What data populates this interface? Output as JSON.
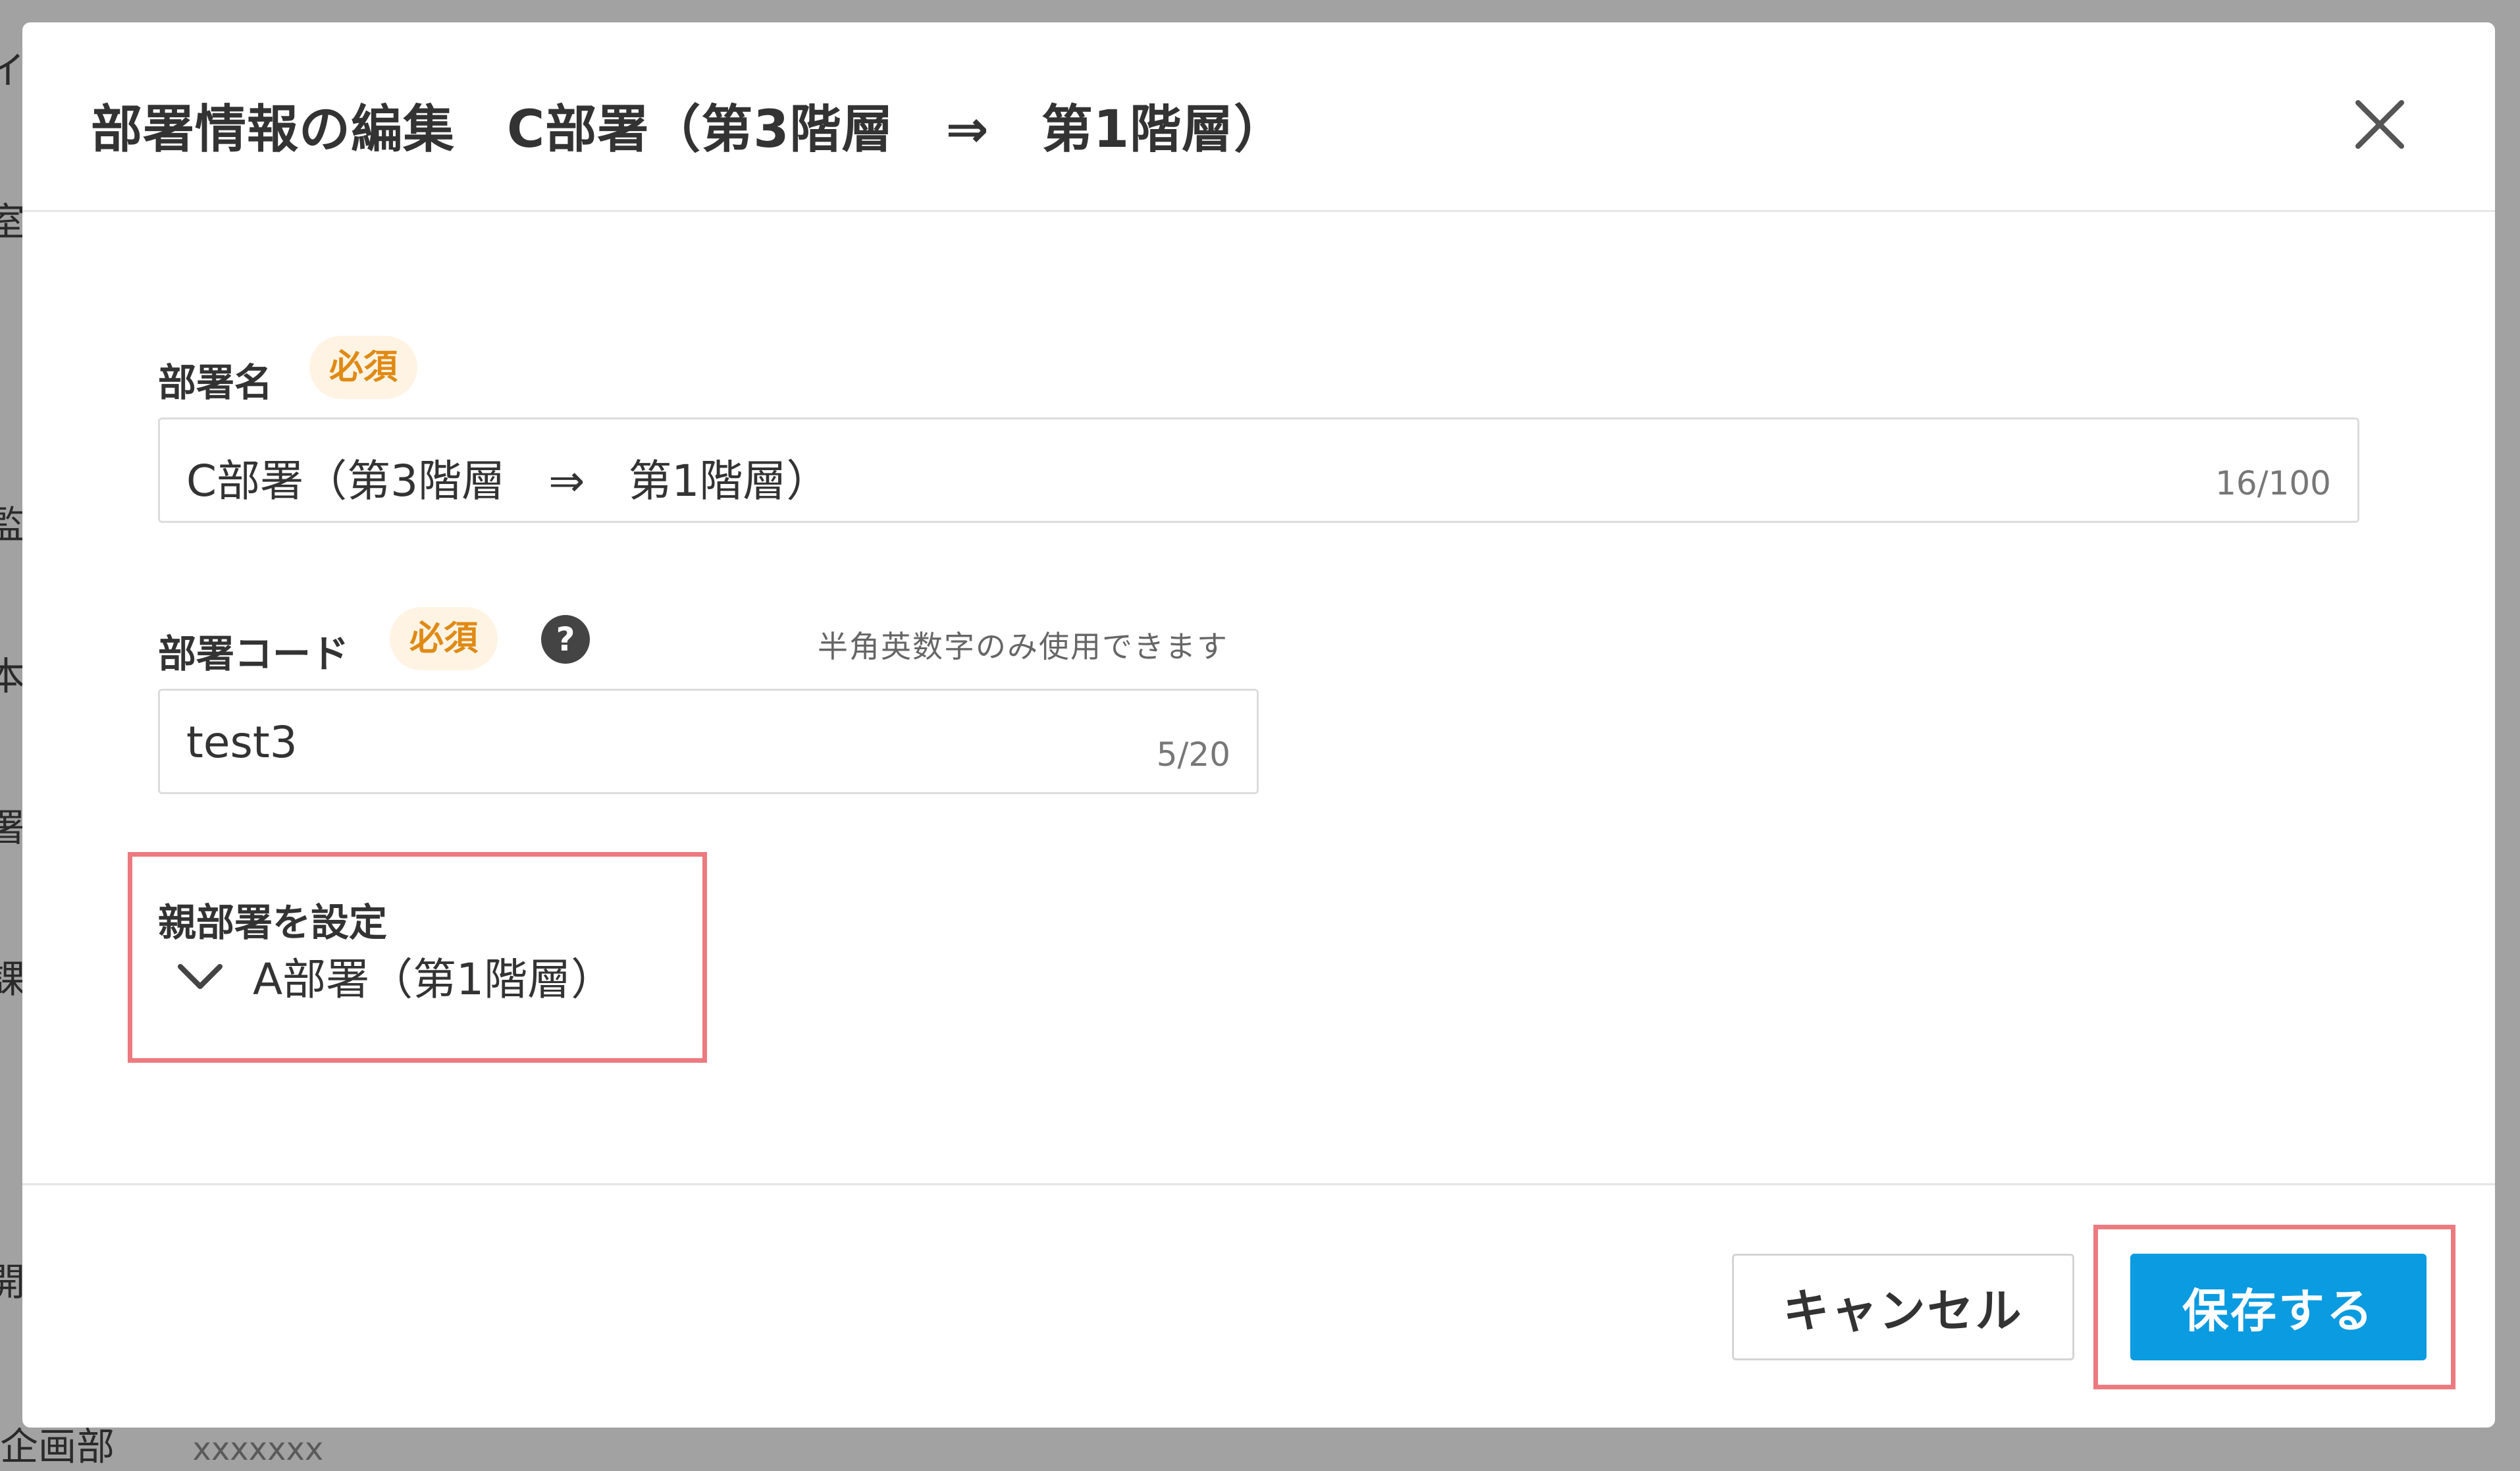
{
  "background": {
    "fragments": [
      "イ",
      "室",
      "監",
      "本",
      "署",
      "課",
      "開"
    ],
    "bottom_name": "企画部",
    "bottom_value": "xxxxxxx"
  },
  "dialog": {
    "title": "部署情報の編集　C部署（第3階層　⇒　第1階層）",
    "close_icon": "close-icon"
  },
  "department_name": {
    "label": "部署名",
    "required_badge": "必須",
    "value": "C部署（第3階層　⇒　第1階層）",
    "counter": "16/100"
  },
  "department_code": {
    "label": "部署コード",
    "required_badge": "必須",
    "help_icon": "question-circle-icon",
    "hint": "半角英数字のみ使用できます",
    "value": "test3",
    "counter": "5/20"
  },
  "parent_department": {
    "label": "親部署を設定",
    "chevron_icon": "chevron-down-icon",
    "selected": "A部署（第1階層）"
  },
  "footer": {
    "cancel_label": "キャンセル",
    "save_label": "保存する"
  },
  "colors": {
    "accent": "#0a9be0",
    "required_text": "#e08a14",
    "required_bg": "#fff4e4",
    "highlight": "#ec7a80",
    "overlay": "#a2a2a2"
  }
}
